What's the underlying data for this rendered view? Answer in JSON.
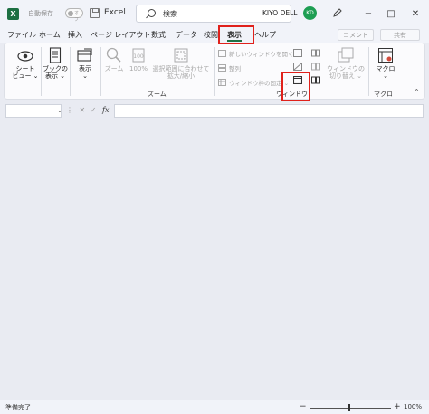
{
  "titlebar": {
    "logo_letter": "X",
    "autosave_label": "自動保存",
    "toggle_state": "オフ",
    "app_name": "Excel",
    "search_placeholder": "検索",
    "user_name": "KIYO DELL",
    "avatar_initials": "KD",
    "minimize": "−",
    "maximize": "□",
    "close": "✕"
  },
  "tabs": [
    {
      "label": "ファイル"
    },
    {
      "label": "ホーム"
    },
    {
      "label": "挿入"
    },
    {
      "label": "ページ レイアウト"
    },
    {
      "label": "数式"
    },
    {
      "label": "データ"
    },
    {
      "label": "校閲"
    },
    {
      "label": "表示"
    },
    {
      "label": "ヘルプ"
    }
  ],
  "active_tab": "表示",
  "actions": {
    "comment": "コメント",
    "share": "共有"
  },
  "ribbon": {
    "sheet_view": "シート\nビュー ⌄",
    "workbook_view": "ブックの\n表示 ⌄",
    "show": "表示\n⌄",
    "zoom": "ズーム",
    "zoom_100": "100%",
    "zoom_selection": "選択範囲に合わせて\n拡大/縮小",
    "zoom_group": "ズーム",
    "new_window": "新しいウィンドウを開く",
    "arrange_all": "整列",
    "freeze_panes": "ウィンドウ枠の固定 ⌄",
    "window_group": "ウィンドウ",
    "switch_windows": "ウィンドウの\n切り替え ⌄",
    "macros": "マクロ\n⌄",
    "macros_group": "マクロ",
    "collapse": "⌃"
  },
  "formula_bar": {
    "namebox_arrow": "⌄",
    "dots": "⋮",
    "cancel": "✕",
    "enter": "✓",
    "fx": "fx"
  },
  "status": {
    "ready": "準備完了",
    "zoom_minus": "−",
    "zoom_plus": "+",
    "zoom_level": "100%"
  },
  "colors": {
    "highlight": "#e0211b",
    "excel_green": "#1d6f42",
    "avatar": "#1e9e53"
  }
}
